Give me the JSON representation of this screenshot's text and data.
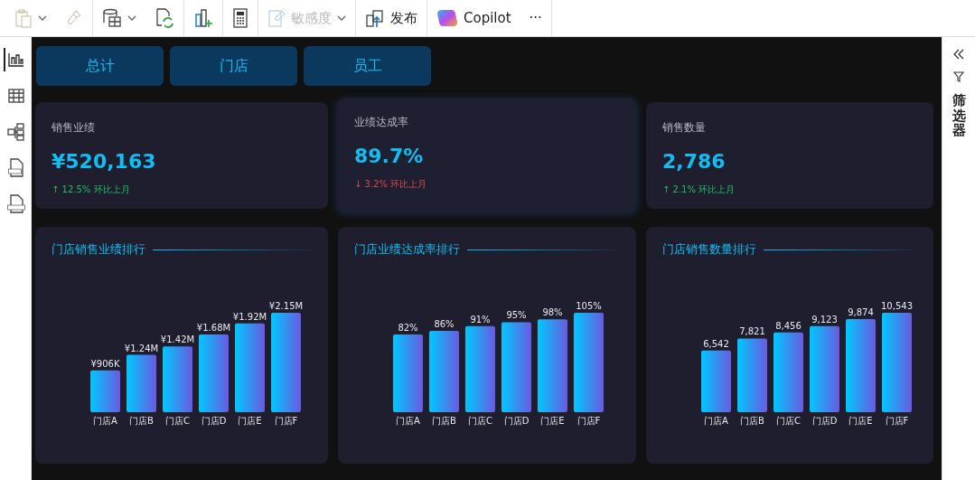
{
  "toolbar": [
    {
      "kind": "paste",
      "disabled": true,
      "caret": true
    },
    {
      "kind": "format-painter",
      "disabled": true,
      "caret": false,
      "group_end": true
    },
    {
      "kind": "dataset",
      "disabled": false,
      "caret": true
    },
    {
      "kind": "refresh",
      "disabled": false,
      "caret": false,
      "group_end": true
    },
    {
      "kind": "new-visual",
      "disabled": false,
      "caret": false,
      "group_end": true
    },
    {
      "kind": "calculator",
      "disabled": false,
      "caret": false,
      "group_end": true
    },
    {
      "kind": "sensitivity",
      "label": "敏感度",
      "disabled": true,
      "caret": true,
      "group_end": true
    },
    {
      "kind": "publish",
      "label": "发布",
      "disabled": false,
      "caret": false,
      "group_end": true
    },
    {
      "kind": "copilot",
      "label": "Copilot",
      "disabled": false,
      "caret": false
    },
    {
      "kind": "more",
      "label": "···",
      "disabled": false,
      "caret": false,
      "group_end": true
    }
  ],
  "sidebar": {
    "items": [
      {
        "kind": "report",
        "selected": true
      },
      {
        "kind": "table",
        "selected": false
      },
      {
        "kind": "model",
        "selected": false
      },
      {
        "kind": "dax",
        "selected": false
      },
      {
        "kind": "tmdl",
        "selected": false
      }
    ]
  },
  "tabs": [
    {
      "label": "总计"
    },
    {
      "label": "门店"
    },
    {
      "label": "员工"
    }
  ],
  "kpis": [
    {
      "title": "销售业绩",
      "value": "¥520,163",
      "delta": "↑ 12.5% 环比上月",
      "color": "#1fbf64",
      "hovered": false
    },
    {
      "title": "业绩达成率",
      "value": "89.7%",
      "delta": "↓ 3.2% 环比上月",
      "color": "#e0474c",
      "hovered": true
    },
    {
      "title": "销售数量",
      "value": "2,786",
      "delta": "↑ 2.1% 环比上月",
      "color": "#1fbf64",
      "hovered": false
    }
  ],
  "charts": [
    {
      "title": "门店销售业绩排行",
      "chart_data": {
        "type": "bar",
        "categories": [
          "门店A",
          "门店B",
          "门店C",
          "门店D",
          "门店E",
          "门店F"
        ],
        "values": [
          906000,
          1240000,
          1420000,
          1680000,
          1920000,
          2150000
        ],
        "value_labels": [
          "¥906K",
          "¥1.24M",
          "¥1.42M",
          "¥1.68M",
          "¥1.92M",
          "¥2.15M"
        ]
      }
    },
    {
      "title": "门店业绩达成率排行",
      "chart_data": {
        "type": "bar",
        "categories": [
          "门店A",
          "门店B",
          "门店C",
          "门店D",
          "门店E",
          "门店F"
        ],
        "values": [
          82,
          86,
          91,
          95,
          98,
          105
        ],
        "value_labels": [
          "82%",
          "86%",
          "91%",
          "95%",
          "98%",
          "105%"
        ]
      }
    },
    {
      "title": "门店销售数量排行",
      "chart_data": {
        "type": "bar",
        "categories": [
          "门店A",
          "门店B",
          "门店C",
          "门店D",
          "门店E",
          "门店F"
        ],
        "values": [
          6542,
          7821,
          8456,
          9123,
          9874,
          10543
        ],
        "value_labels": [
          "6,542",
          "7,821",
          "8,456",
          "9,123",
          "9,874",
          "10,543"
        ]
      }
    }
  ],
  "filter_pane": {
    "title": "筛选器"
  }
}
